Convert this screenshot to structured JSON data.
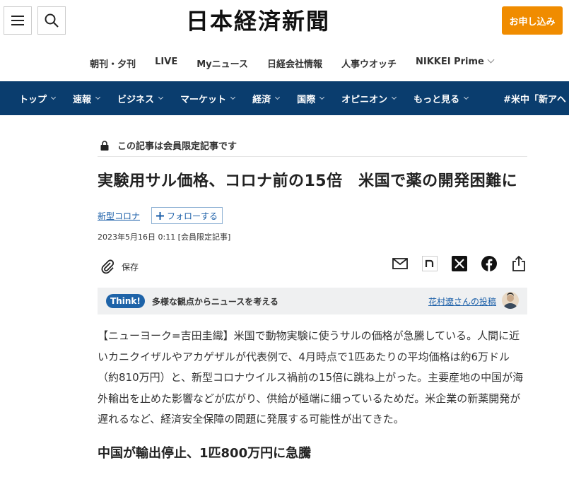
{
  "header": {
    "logo": "日本経済新聞",
    "signup_label": "お申し込み"
  },
  "icons": {
    "menu": "hamburger-icon",
    "search": "search-icon",
    "lock": "lock-icon",
    "save": "paperclip-icon",
    "mail": "mail-icon",
    "note": "note-icon",
    "x": "x-icon",
    "facebook": "facebook-icon",
    "share": "share-icon"
  },
  "subnav": {
    "items": [
      "朝刊・夕刊",
      "LIVE",
      "Myニュース",
      "日経会社情報",
      "人事ウオッチ",
      "NIKKEI Prime"
    ]
  },
  "mainnav": {
    "items": [
      "トップ",
      "速報",
      "ビジネス",
      "マーケット",
      "経済",
      "国際",
      "オピニオン",
      "もっと見る"
    ],
    "trending": "#米中「新アヘ"
  },
  "article": {
    "members_only": "この記事は会員限定記事です",
    "title": "実験用サル価格、コロナ前の15倍　米国で薬の開発困難に",
    "tag": "新型コロナ",
    "follow_label": "フォローする",
    "date": "2023年5月16日 0:11 [会員限定記事]",
    "save_label": "保存",
    "think_badge": "Think!",
    "think_text": "多様な観点からニュースを考える",
    "think_link": "花村遼さんの投稿",
    "body": "【ニューヨーク=吉田圭織】米国で動物実験に使うサルの価格が急騰している。人間に近いカニクイザルやアカゲザルが代表例で、4月時点で1匹あたりの平均価格は約6万ドル（約810万円）と、新型コロナウイルス禍前の15倍に跳ね上がった。主要産地の中国が海外輸出を止めた影響などが広がり、供給が極端に細っているためだ。米企業の新薬開発が遅れるなど、経済安全保障の問題に発展する可能性が出てきた。",
    "subheading": "中国が輸出停止、1匹800万円に急騰"
  },
  "colors": {
    "nav_blue": "#0a3d6e",
    "signup_orange": "#f08c00",
    "link_blue": "#1a5ea8"
  }
}
